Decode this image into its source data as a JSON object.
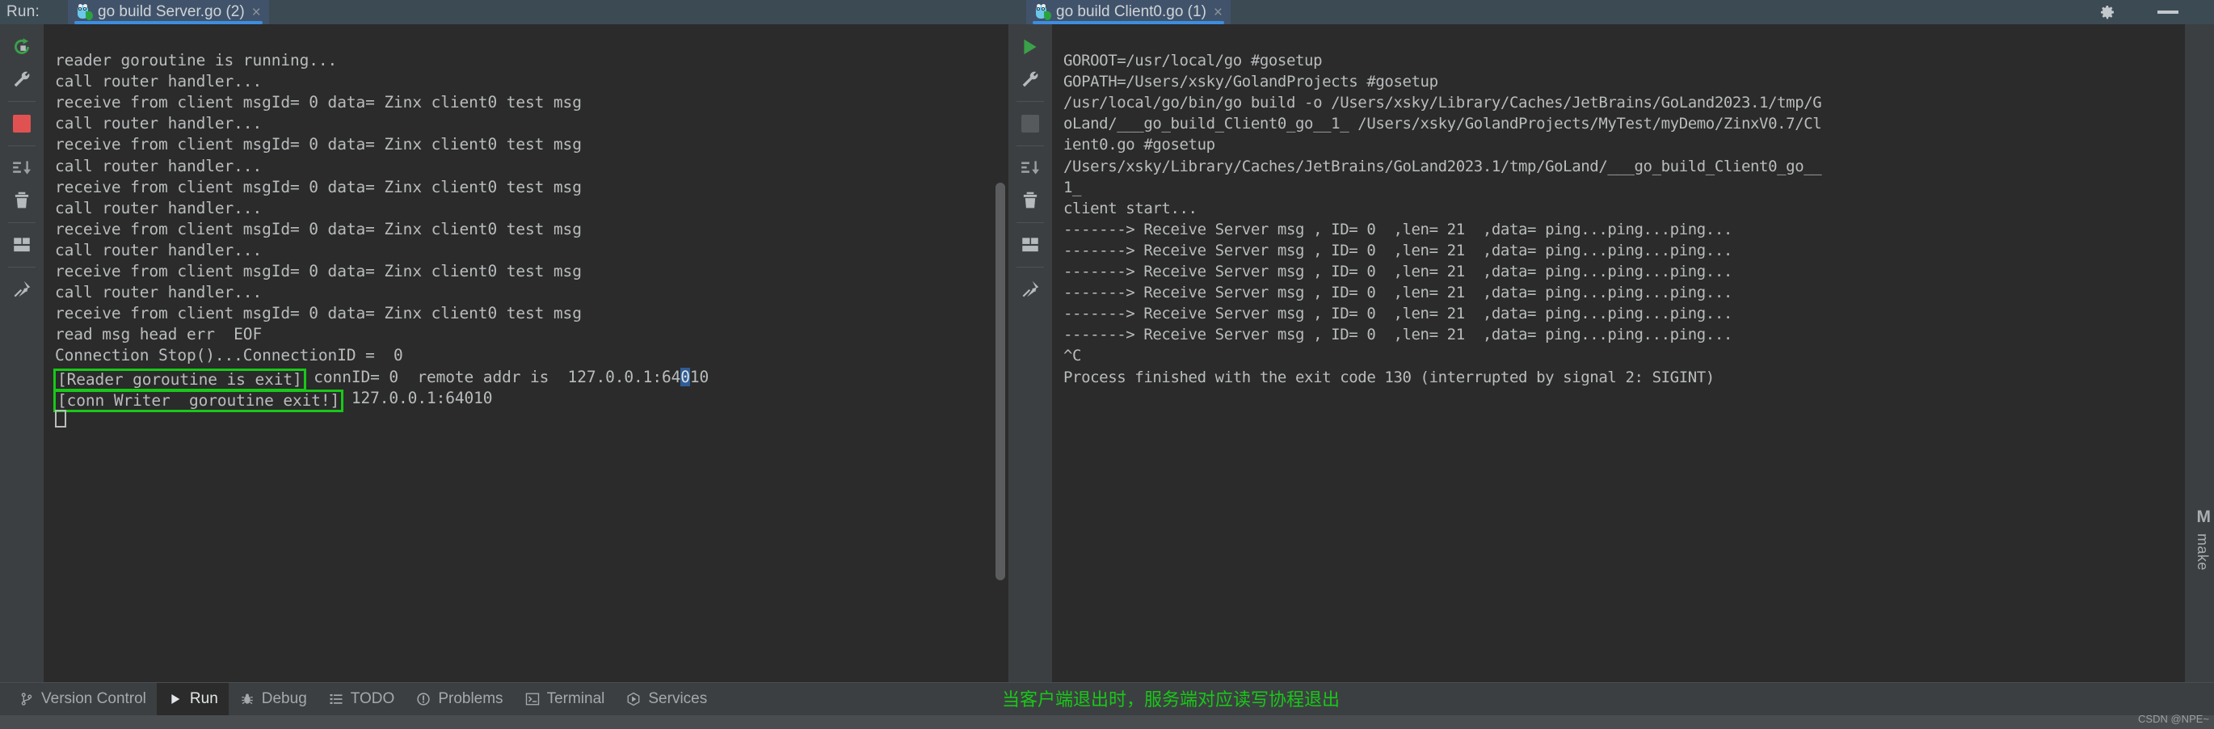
{
  "window": {
    "run_label": "Run:",
    "gear_icon": "gear-icon",
    "minimize_icon": "minimize-icon"
  },
  "tabs": [
    {
      "title": "go build Server.go (2)",
      "icon": "go-gopher-icon",
      "close": "×",
      "active": true
    },
    {
      "title": "go build Client0.go (1)",
      "icon": "go-gopher-icon",
      "close": "×",
      "active": true
    }
  ],
  "left_gutter": [
    {
      "name": "rerun-button",
      "icon": "rerun-icon",
      "color": "#3aa14a"
    },
    {
      "name": "settings-button",
      "icon": "wrench-icon",
      "color": "#b5babd"
    },
    {
      "name": "stop-button",
      "icon": "stop-square-icon",
      "color": "#e05252"
    },
    {
      "name": "scroll-to-end-button",
      "icon": "scroll-to-end-icon",
      "color": "#9ba0a3"
    },
    {
      "name": "clear-all-button",
      "icon": "trash-icon",
      "color": "#b5babd"
    },
    {
      "name": "layout-button",
      "icon": "layout-icon",
      "color": "#b5babd"
    },
    {
      "name": "pin-tab-button",
      "icon": "pin-icon",
      "color": "#b5babd"
    }
  ],
  "right_gutter": [
    {
      "name": "run-button",
      "icon": "play-icon",
      "color": "#3aa14a"
    },
    {
      "name": "settings-button",
      "icon": "wrench-icon",
      "color": "#b5babd"
    },
    {
      "name": "stop-button",
      "icon": "stop-square-icon",
      "color": "#565a5c"
    },
    {
      "name": "scroll-to-end-button",
      "icon": "scroll-to-end-icon",
      "color": "#9ba0a3"
    },
    {
      "name": "clear-all-button",
      "icon": "trash-icon",
      "color": "#b5babd"
    },
    {
      "name": "layout-button",
      "icon": "layout-icon",
      "color": "#b5babd"
    },
    {
      "name": "pin-tab-button",
      "icon": "pin-icon",
      "color": "#b5babd"
    }
  ],
  "server_console": {
    "lines": [
      "reader goroutine is running...",
      "call router handler...",
      "receive from client msgId= 0 data= Zinx client0 test msg",
      "call router handler...",
      "receive from client msgId= 0 data= Zinx client0 test msg",
      "call router handler...",
      "receive from client msgId= 0 data= Zinx client0 test msg",
      "call router handler...",
      "receive from client msgId= 0 data= Zinx client0 test msg",
      "call router handler...",
      "receive from client msgId= 0 data= Zinx client0 test msg",
      "call router handler...",
      "receive from client msgId= 0 data= Zinx client0 test msg",
      "read msg head err  EOF",
      "Connection Stop()...ConnectionID =  0"
    ],
    "highlight_line_1": {
      "boxed": "[Reader goroutine is exit]",
      "rest_before_selection": " connID= 0  remote addr is  127.0.0.1:64",
      "selected": "0",
      "rest_after_selection": "10"
    },
    "highlight_line_2": {
      "boxed": "[conn Writer  goroutine exit!]",
      "rest": " 127.0.0.1:64010"
    },
    "highlight_color": "#18c818",
    "selection_color": "#2f5d96"
  },
  "client_console": {
    "lines": [
      "GOROOT=/usr/local/go #gosetup",
      "GOPATH=/Users/xsky/GolandProjects #gosetup",
      "/usr/local/go/bin/go build -o /Users/xsky/Library/Caches/JetBrains/GoLand2023.1/tmp/G",
      "oLand/___go_build_Client0_go__1_ /Users/xsky/GolandProjects/MyTest/myDemo/ZinxV0.7/Cl",
      "ient0.go #gosetup",
      "/Users/xsky/Library/Caches/JetBrains/GoLand2023.1/tmp/GoLand/___go_build_Client0_go__",
      "1_",
      "client start...",
      "-------> Receive Server msg , ID= 0  ,len= 21  ,data= ping...ping...ping...",
      "-------> Receive Server msg , ID= 0  ,len= 21  ,data= ping...ping...ping...",
      "-------> Receive Server msg , ID= 0  ,len= 21  ,data= ping...ping...ping...",
      "-------> Receive Server msg , ID= 0  ,len= 21  ,data= ping...ping...ping...",
      "-------> Receive Server msg , ID= 0  ,len= 21  ,data= ping...ping...ping...",
      "-------> Receive Server msg , ID= 0  ,len= 21  ,data= ping...ping...ping...",
      "^C",
      "Process finished with the exit code 130 (interrupted by signal 2: SIGINT)"
    ]
  },
  "statusbar": {
    "items": [
      {
        "label": "Version Control",
        "icon": "branch-icon",
        "active": false
      },
      {
        "label": "Run",
        "icon": "play-icon",
        "active": true
      },
      {
        "label": "Debug",
        "icon": "bug-icon",
        "active": false
      },
      {
        "label": "TODO",
        "icon": "list-icon",
        "active": false
      },
      {
        "label": "Problems",
        "icon": "exclamation-circle-icon",
        "active": false
      },
      {
        "label": "Terminal",
        "icon": "terminal-icon",
        "active": false
      },
      {
        "label": "Services",
        "icon": "services-icon",
        "active": false
      }
    ]
  },
  "annotation": {
    "text": "当客户端退出时，服务端对应读写协程退出",
    "color": "#18c818"
  },
  "edge": {
    "m_label": "M",
    "vertical_label": "make"
  },
  "watermark": {
    "text": "CSDN @NPE~"
  }
}
